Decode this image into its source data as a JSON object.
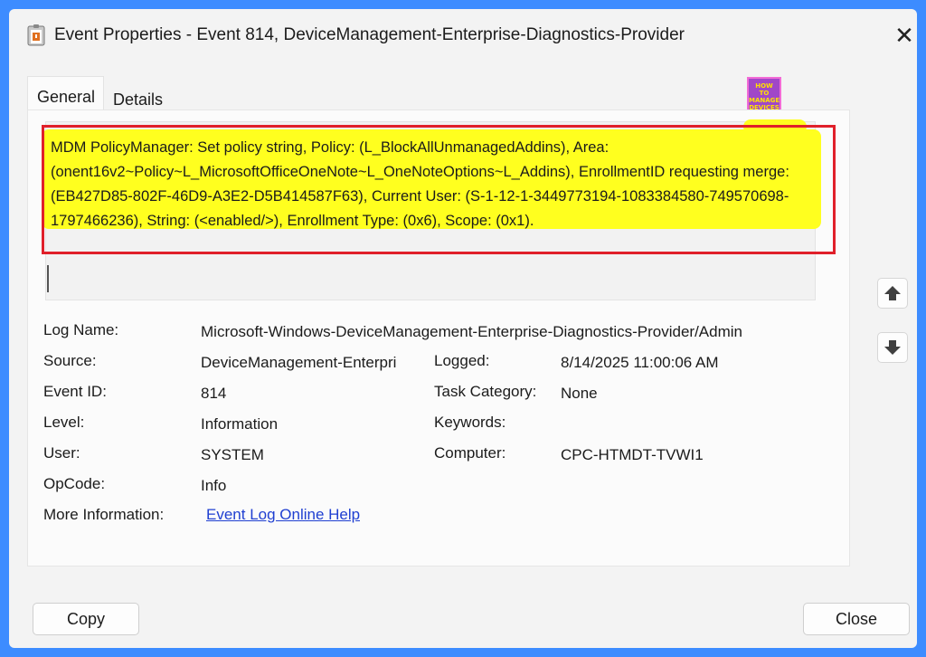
{
  "window": {
    "title": "Event Properties - Event 814, DeviceManagement-Enterprise-Diagnostics-Provider",
    "close_glyph": "✕"
  },
  "tabs": [
    {
      "label": "General",
      "selected": true
    },
    {
      "label": "Details",
      "selected": false
    }
  ],
  "logo": {
    "line1": "HOW",
    "line2": "TO",
    "line3": "MANAGE",
    "line4": "DEVICES"
  },
  "message": "MDM PolicyManager: Set policy string, Policy: (L_BlockAllUnmanagedAddins), Area: (onent16v2~Policy~L_MicrosoftOfficeOneNote~L_OneNoteOptions~L_Addins), EnrollmentID requesting merge: (EB427D85-802F-46D9-A3E2-D5B414587F63), Current User: (S-1-12-1-3449773194-1083384580-749570698-1797466236), String: (<enabled/>), Enrollment Type: (0x6), Scope: (0x1).",
  "fields": {
    "log_name_label": "Log Name:",
    "log_name": "Microsoft-Windows-DeviceManagement-Enterprise-Diagnostics-Provider/Admin",
    "source_label": "Source:",
    "source": "DeviceManagement-Enterpri",
    "logged_label": "Logged:",
    "logged": "8/14/2025 11:00:06 AM",
    "event_id_label": "Event ID:",
    "event_id": "814",
    "task_category_label": "Task Category:",
    "task_category": "None",
    "level_label": "Level:",
    "level": "Information",
    "keywords_label": "Keywords:",
    "keywords": "",
    "user_label": "User:",
    "user": "SYSTEM",
    "computer_label": "Computer:",
    "computer": "CPC-HTMDT-TVWI1",
    "opcode_label": "OpCode:",
    "opcode": "Info",
    "more_info_label": "More Information:",
    "more_info_link": "Event Log Online Help"
  },
  "buttons": {
    "copy": "Copy",
    "close": "Close"
  },
  "colors": {
    "background": "#3d8cff",
    "highlight": "#ffff1f",
    "annotation_border": "#e0202a",
    "link": "#1f3fd1"
  },
  "icons": {
    "app": "event-viewer-icon",
    "up": "arrow-up-icon",
    "down": "arrow-down-icon",
    "close": "close-icon"
  }
}
